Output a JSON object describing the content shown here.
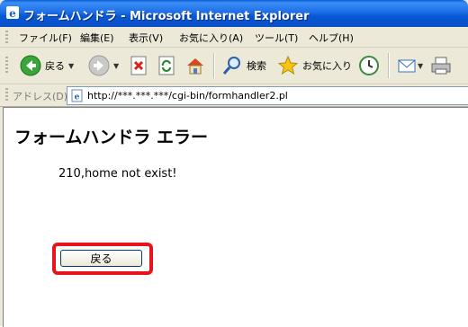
{
  "window": {
    "title": "フォームハンドラ - Microsoft Internet Explorer"
  },
  "menubar": {
    "items": [
      "ファイル(F)",
      "編集(E)",
      "表示(V)",
      "お気に入り(A)",
      "ツール(T)",
      "ヘルプ(H)"
    ]
  },
  "toolbar": {
    "back_label": "戻る",
    "search_label": "検索",
    "favorites_label": "お気に入り",
    "icons": [
      "back-icon",
      "forward-icon",
      "stop-icon",
      "refresh-icon",
      "home-icon",
      "search-icon",
      "favorites-icon",
      "history-icon",
      "mail-icon",
      "print-icon"
    ]
  },
  "address": {
    "label": "アドレス(D)",
    "url": "http://***.***.***/cgi-bin/formhandler2.pl"
  },
  "page": {
    "heading": "フォームハンドラ エラー",
    "message": "210,home not exist!",
    "back_button": "戻る"
  },
  "colors": {
    "titlebar": "#0a58d4",
    "highlight": "#e8141c",
    "chrome": "#ece9d8"
  }
}
